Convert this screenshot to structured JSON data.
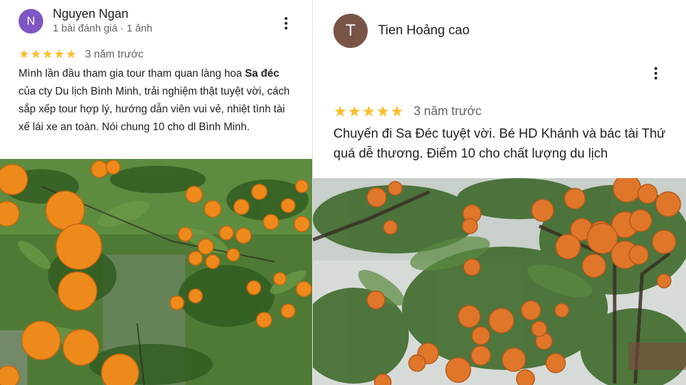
{
  "reviews": [
    {
      "avatar_letter": "N",
      "avatar_color": "#7e57c2",
      "author": "Nguyen Ngan",
      "meta": "1 bài đánh giá · 1 ảnh",
      "stars": "★★★★★",
      "rating": 5,
      "time": "3 năm trước",
      "text_before": "Mình lần đầu tham gia tour tham quan làng hoa ",
      "text_bold": "Sa đéc",
      "text_after": " của cty Du lịch Bình Minh, trải nghiệm thật tuyệt vời, cách sắp xếp tour hợp lý, hướng dẫn viên vui vẻ, nhiệt tình tài xế lái xe an toàn. Nói chung 10 cho dl Bình Minh.",
      "photo_icon": "orange-tree-photo"
    },
    {
      "avatar_letter": "T",
      "avatar_color": "#795548",
      "author": "Tien Hoảng cao",
      "stars": "★★★★★",
      "rating": 5,
      "time": "3 năm trước",
      "text": "Chuyến đi Sa Đéc tuyệt vời. Bé HD Khánh và bác tài Thứ quá dễ thương. Điểm 10 cho chất lượng du lịch",
      "photo_icon": "orange-tree-photo"
    }
  ],
  "colors": {
    "star": "#f9bf2a",
    "secondary_text": "#5f6368",
    "orange": "#ee8a1c",
    "leaf": "#3d6a2a"
  }
}
